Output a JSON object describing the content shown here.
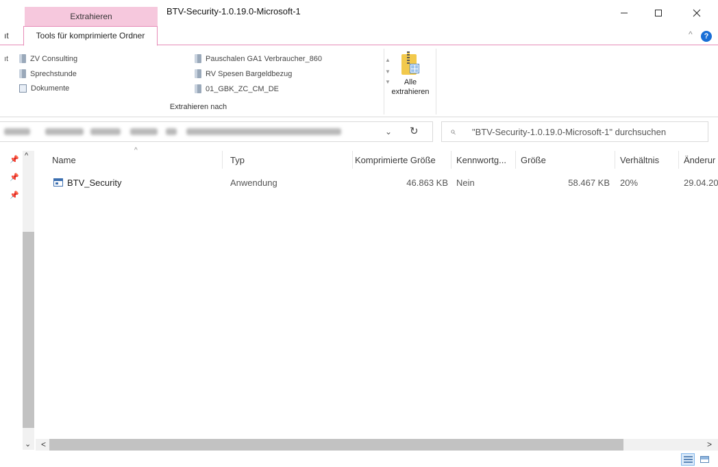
{
  "window": {
    "title": "BTV-Security-1.0.19.0-Microsoft-1",
    "context_tab_header": "Extrahieren",
    "min_icon": "minimize-icon",
    "max_icon": "maximize-icon",
    "close_icon": "close-icon"
  },
  "ribbon": {
    "left_tab_cut": "ıt",
    "active_tab": "Tools für komprimierte Ordner",
    "left_ribbon_cut": "ıt",
    "destinations": [
      {
        "label": "ZV Consulting",
        "icon": "folder-icon"
      },
      {
        "label": "Sprechstunde",
        "icon": "folder-icon"
      },
      {
        "label": "Dokumente",
        "icon": "documents-icon"
      },
      {
        "label": "Pauschalen GA1 Verbraucher_860",
        "icon": "folder-icon"
      },
      {
        "label": "RV Spesen Bargeldbezug",
        "icon": "folder-icon"
      },
      {
        "label": "01_GBK_ZC_CM_DE",
        "icon": "folder-icon"
      }
    ],
    "group_label": "Extrahieren nach",
    "extract_all_line1": "Alle",
    "extract_all_line2": "extrahieren"
  },
  "address": {
    "search_placeholder": "\"BTV-Security-1.0.19.0-Microsoft-1\" durchsuchen"
  },
  "columns": [
    "Name",
    "Typ",
    "Komprimierte Größe",
    "Kennwortg...",
    "Größe",
    "Verhältnis",
    "Änderur"
  ],
  "files": [
    {
      "name": "BTV_Security",
      "type": "Anwendung",
      "compressed_size": "46.863 KB",
      "password": "Nein",
      "size": "58.467 KB",
      "ratio": "20%",
      "modified": "29.04.20"
    }
  ],
  "colors": {
    "context_tab": "#f6c8dd",
    "accent_border": "#e68ab7",
    "help_blue": "#1a6fd6"
  }
}
